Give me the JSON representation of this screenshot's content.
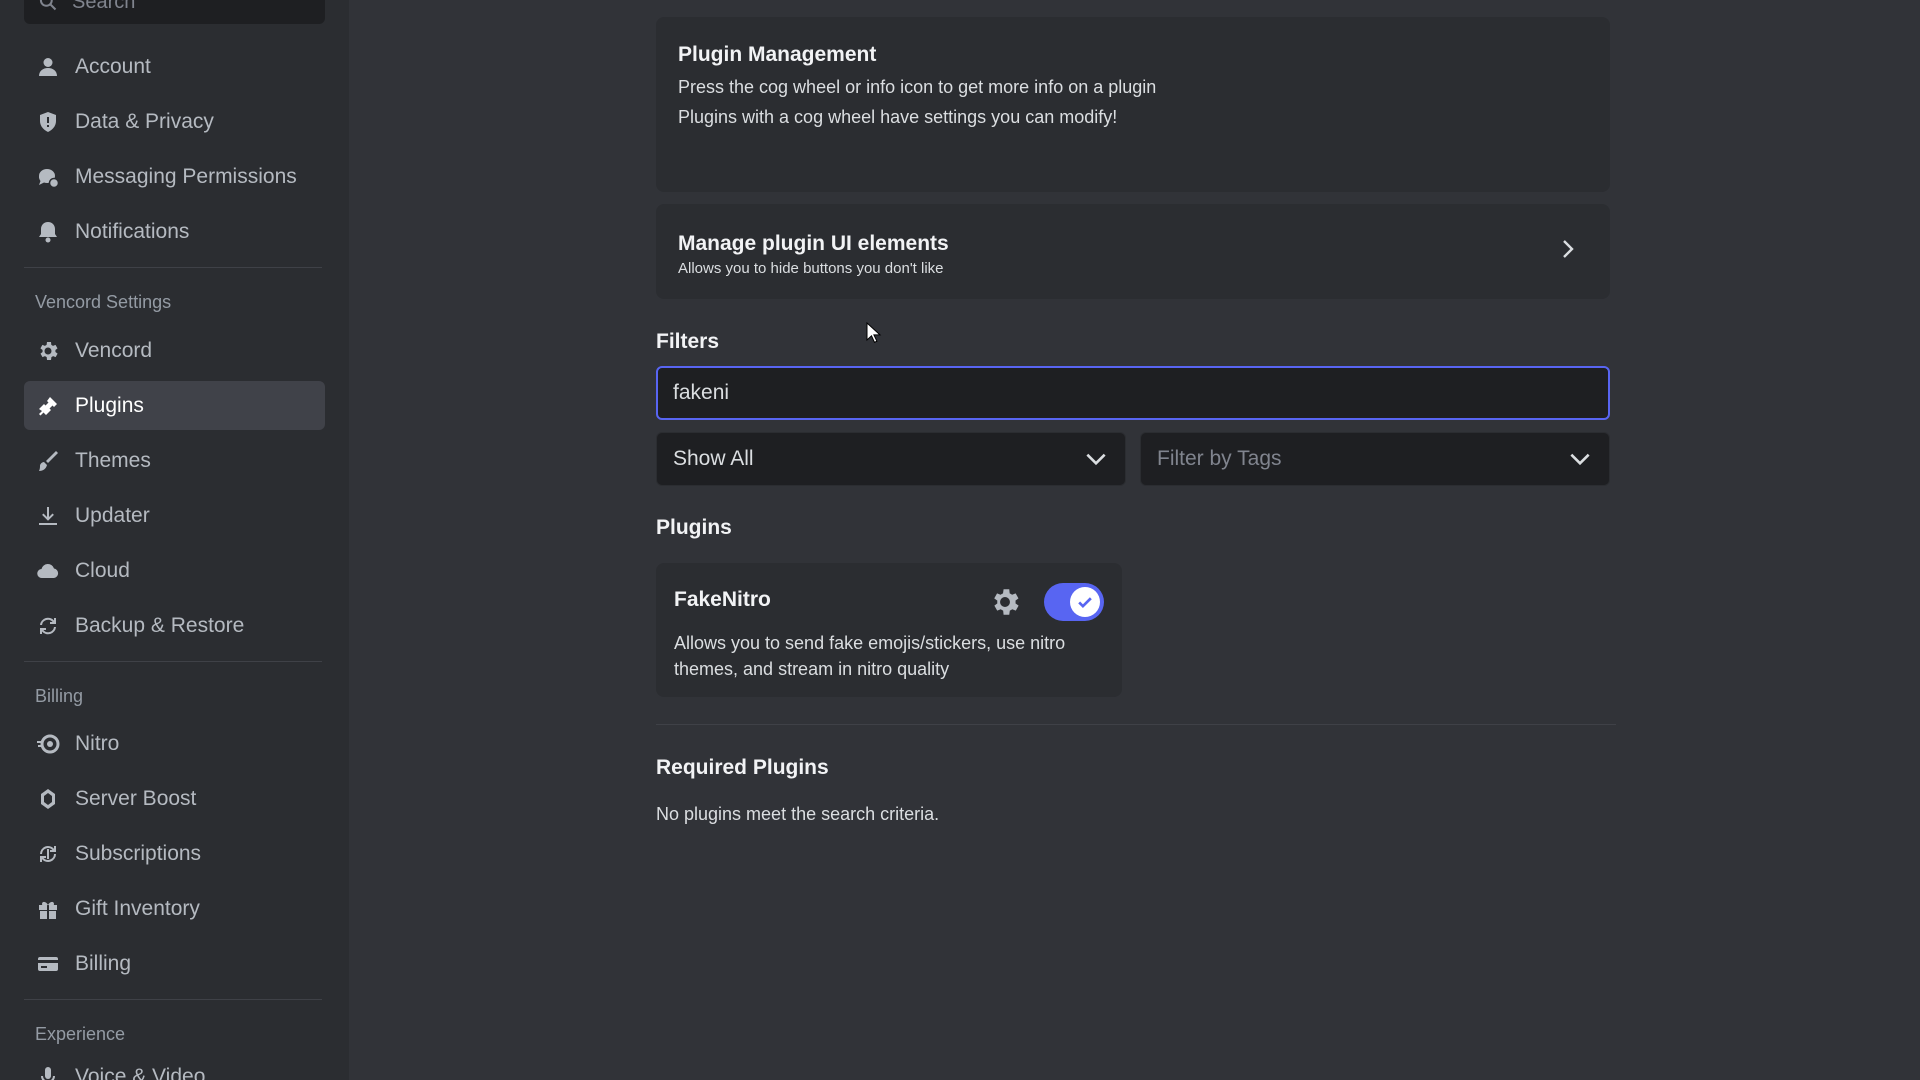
{
  "sidebar": {
    "search_placeholder": "Search",
    "user_items": [
      {
        "label": "Account",
        "icon": "person-icon"
      },
      {
        "label": "Data & Privacy",
        "icon": "shield-icon"
      },
      {
        "label": "Messaging Permissions",
        "icon": "messaging-permissions-icon"
      },
      {
        "label": "Notifications",
        "icon": "bell-icon"
      }
    ],
    "vencord_header": "Vencord Settings",
    "vencord_items": [
      {
        "label": "Vencord",
        "icon": "gear-icon"
      },
      {
        "label": "Plugins",
        "icon": "plug-icon",
        "active": true
      },
      {
        "label": "Themes",
        "icon": "brush-icon"
      },
      {
        "label": "Updater",
        "icon": "download-icon"
      },
      {
        "label": "Cloud",
        "icon": "cloud-icon"
      },
      {
        "label": "Backup & Restore",
        "icon": "sync-icon"
      }
    ],
    "billing_header": "Billing",
    "billing_items": [
      {
        "label": "Nitro",
        "icon": "nitro-icon"
      },
      {
        "label": "Server Boost",
        "icon": "boost-icon"
      },
      {
        "label": "Subscriptions",
        "icon": "subscriptions-icon"
      },
      {
        "label": "Gift Inventory",
        "icon": "gift-icon"
      },
      {
        "label": "Billing",
        "icon": "card-icon"
      }
    ],
    "experience_header": "Experience",
    "experience_items": [
      {
        "label": "Voice & Video",
        "icon": "microphone-icon"
      }
    ]
  },
  "main": {
    "plugin_management": {
      "title": "Plugin Management",
      "line1": "Press the cog wheel or info icon to get more info on a plugin",
      "line2": "Plugins with a cog wheel have settings you can modify!"
    },
    "manage_ui": {
      "title": "Manage plugin UI elements",
      "subtitle": "Allows you to hide buttons you don't like"
    },
    "filters_heading": "Filters",
    "search_value": "fakeni",
    "show_select": "Show All",
    "tags_select_placeholder": "Filter by Tags",
    "plugins_heading": "Plugins",
    "plugin": {
      "name": "FakeNitro",
      "description": "Allows you to send fake emojis/stickers, use nitro themes, and stream in nitro quality",
      "enabled": true
    },
    "required_heading": "Required Plugins",
    "no_results": "No plugins meet the search criteria."
  },
  "colors": {
    "accent": "#5865f2",
    "background": "#313338",
    "sidebar": "#2b2d31",
    "input": "#1e1f22"
  }
}
